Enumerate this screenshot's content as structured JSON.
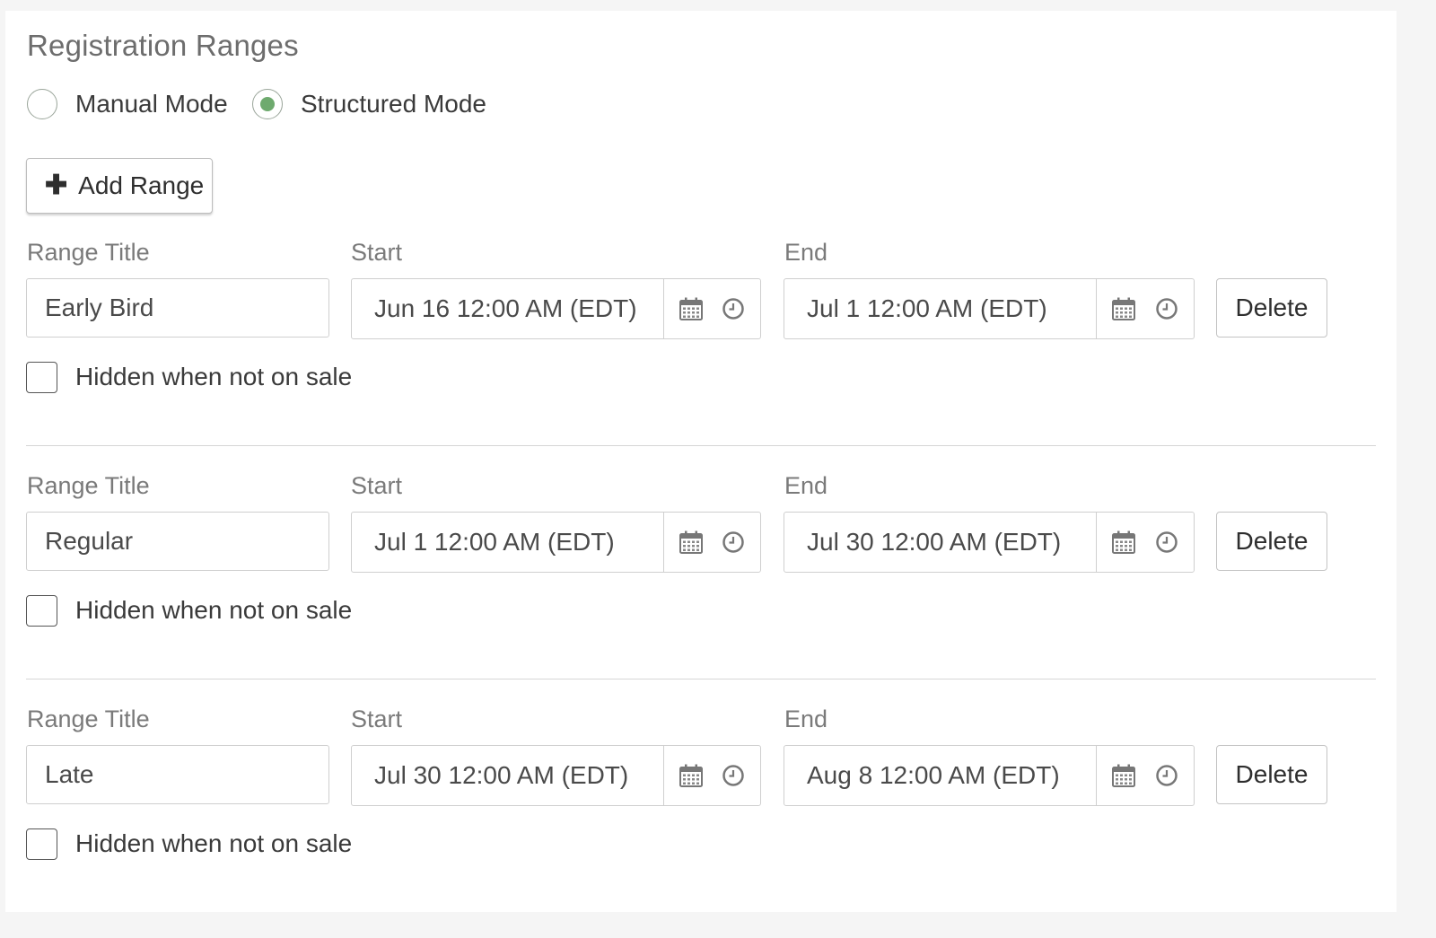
{
  "section_title": "Registration Ranges",
  "modes": {
    "manual": {
      "label": "Manual Mode",
      "checked": false
    },
    "structured": {
      "label": "Structured Mode",
      "checked": true
    }
  },
  "add_range_label": "Add Range",
  "field_labels": {
    "title": "Range Title",
    "start": "Start",
    "end": "End"
  },
  "delete_label": "Delete",
  "hidden_label": "Hidden when not on sale",
  "accent_color": "#6eaa6e",
  "ranges": [
    {
      "title": "Early Bird",
      "start": "Jun 16 12:00 AM (EDT)",
      "end": "Jul 1 12:00 AM (EDT)",
      "hidden": false
    },
    {
      "title": "Regular",
      "start": "Jul 1 12:00 AM (EDT)",
      "end": "Jul 30 12:00 AM (EDT)",
      "hidden": false
    },
    {
      "title": "Late",
      "start": "Jul 30 12:00 AM (EDT)",
      "end": "Aug 8 12:00 AM (EDT)",
      "hidden": false
    }
  ]
}
